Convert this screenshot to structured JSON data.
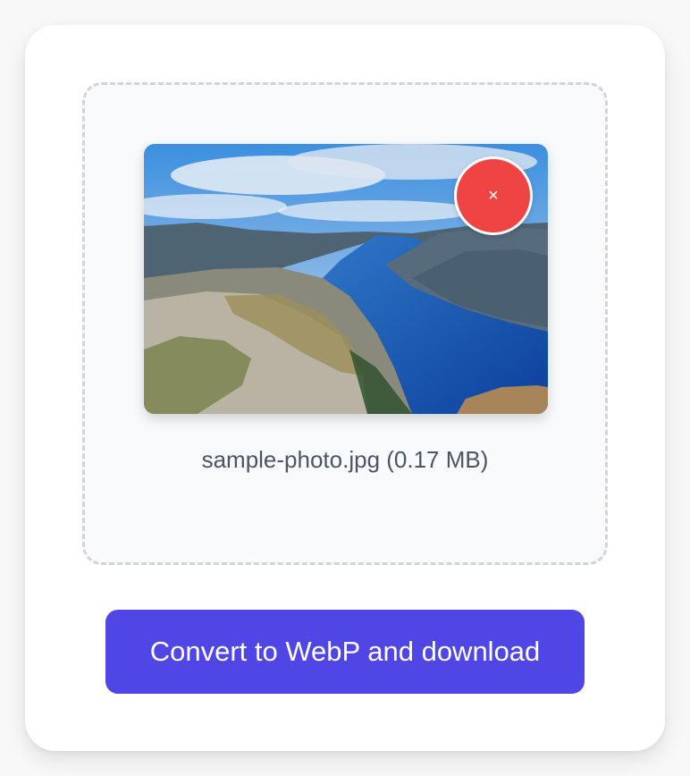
{
  "file": {
    "name": "sample-photo.jpg",
    "size": "(0.17 MB)",
    "display": "sample-photo.jpg (0.17 MB)"
  },
  "remove_button": {
    "glyph": "×",
    "icon": "close-icon"
  },
  "preview": {
    "icon": "fjord-photo-thumbnail"
  },
  "convert_button": {
    "label": "Convert to WebP and download"
  },
  "colors": {
    "accent": "#4f46e5",
    "danger": "#ef4444",
    "dropzone_border": "#d1d5db",
    "text_muted": "#4b5563"
  }
}
